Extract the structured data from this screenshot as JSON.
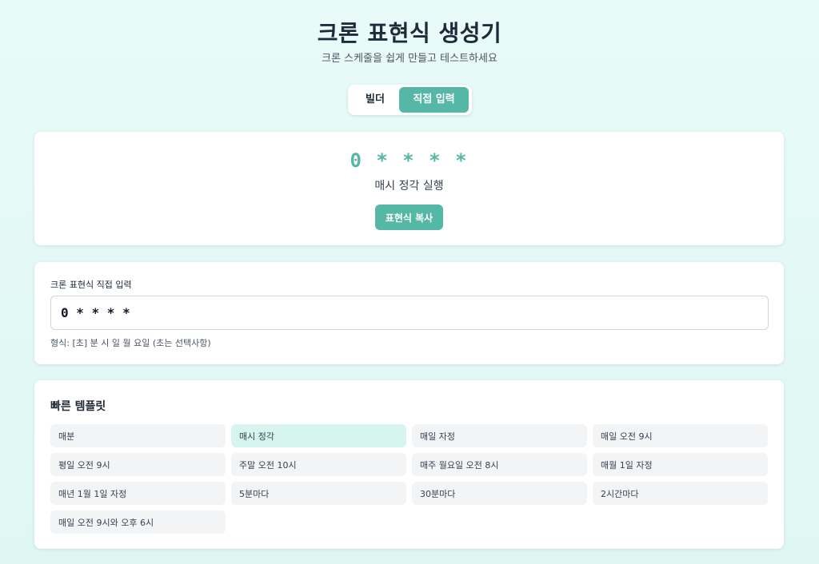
{
  "header": {
    "title": "크론 표현식 생성기",
    "subtitle": "크론 스케줄을 쉽게 만들고 테스트하세요"
  },
  "mode_toggle": {
    "builder_label": "빌더",
    "direct_label": "직접 입력",
    "active": "direct"
  },
  "preview": {
    "expression": "0 * * * *",
    "description": "매시 정각 실행",
    "copy_label": "표현식 복사"
  },
  "direct_input": {
    "label": "크론 표현식 직접 입력",
    "value": "0 * * * *",
    "format_hint": "형식: [초] 분 시 일 월 요일 (초는 선택사항)"
  },
  "templates": {
    "title": "빠른 템플릿",
    "items": [
      {
        "label": "매분"
      },
      {
        "label": "매시 정각"
      },
      {
        "label": "매일 자정"
      },
      {
        "label": "매일 오전 9시"
      },
      {
        "label": "평일 오전 9시"
      },
      {
        "label": "주말 오전 10시"
      },
      {
        "label": "매주 월요일 오전 8시"
      },
      {
        "label": "매월 1일 자정"
      },
      {
        "label": "매년 1월 1일 자정"
      },
      {
        "label": "5분마다"
      },
      {
        "label": "30분마다"
      },
      {
        "label": "2시간마다"
      },
      {
        "label": "매일 오전 9시와 오후 6시"
      }
    ],
    "active_index": 1
  },
  "colors": {
    "accent": "#55b7a5",
    "active_template_bg": "#d5f5ee"
  }
}
